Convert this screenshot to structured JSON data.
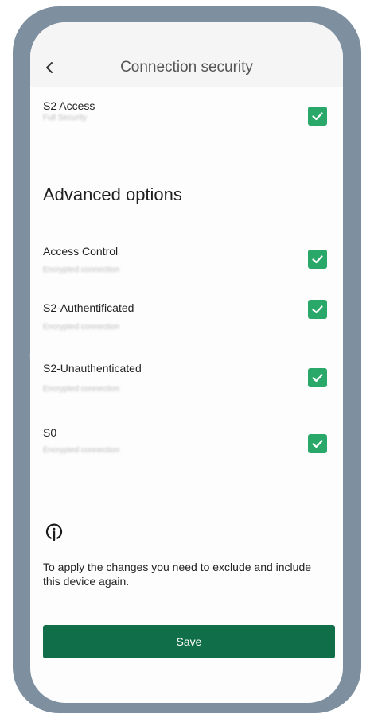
{
  "header": {
    "title": "Connection security",
    "back_icon": "chevron-left-icon"
  },
  "s2_access": {
    "title": "S2 Access",
    "subtitle": "Full Security",
    "checked": true
  },
  "advanced": {
    "title": "Advanced options",
    "items": [
      {
        "title": "Access Control",
        "subtitle": "Encrypted connection",
        "checked": true
      },
      {
        "title": "S2-Authentificated",
        "subtitle": "Encrypted connection",
        "checked": true
      },
      {
        "title": "S2-Unauthenticated",
        "subtitle": "Encrypted connection",
        "checked": true
      },
      {
        "title": "S0",
        "subtitle": "Encrypted connection",
        "checked": true
      }
    ]
  },
  "info": {
    "icon": "info-icon",
    "text": "To apply the changes you need to exclude and include this device again."
  },
  "save_label": "Save",
  "colors": {
    "frame": "#7e8fa0",
    "checkbox": "#2aa869",
    "save_button": "#106f48"
  }
}
